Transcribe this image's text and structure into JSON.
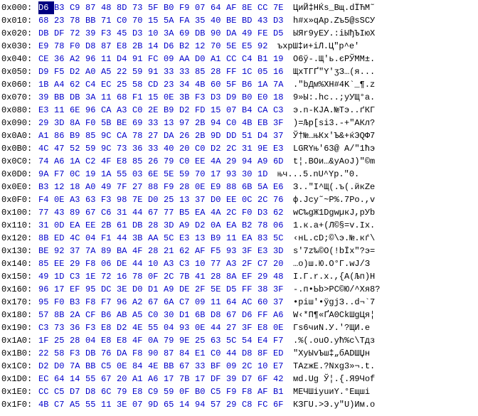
{
  "rows": [
    {
      "addr": "0x000:",
      "bytes": [
        "D6",
        "B3",
        "C9",
        "87",
        "48",
        "8D",
        "73",
        "5F",
        "B0",
        "F9",
        "07",
        "64",
        "AF",
        "8E",
        "CC",
        "7E"
      ],
      "ascii": "ЦиЙ‡HЌs_Вщ.dЇЋМ˜"
    },
    {
      "addr": "0x010:",
      "bytes": [
        "68",
        "23",
        "78",
        "BB",
        "71",
        "C0",
        "70",
        "15",
        "5A",
        "FA",
        "35",
        "40",
        "BE",
        "BD",
        "43",
        "D3"
      ],
      "ascii": "h#x»qАp.Zъ5@sSCУ"
    },
    {
      "addr": "0x020:",
      "bytes": [
        "DB",
        "DF",
        "72",
        "39",
        "F3",
        "45",
        "D3",
        "10",
        "3A",
        "69",
        "DB",
        "90",
        "DA",
        "49",
        "FE",
        "D5"
      ],
      "ascii": "ЫЯr9уEУ.:iЫђЪIюХ"
    },
    {
      "addr": "0x030:",
      "bytes": [
        "E9",
        "78",
        "F0",
        "D8",
        "87",
        "E8",
        "2B",
        "14",
        "D6",
        "B2",
        "12",
        "70",
        "5E",
        "E5",
        "92"
      ],
      "ascii": "ъxpШ‡и+iЛ.Ц\"p^e'"
    },
    {
      "addr": "0x040:",
      "bytes": [
        "CE",
        "36",
        "A2",
        "96",
        "11",
        "D4",
        "91",
        "FC",
        "09",
        "AA",
        "D0",
        "A1",
        "CC",
        "C4",
        "B1",
        "19"
      ],
      "ascii": "О6ў-.Щ'ь.єРЎММ±."
    },
    {
      "addr": "0x050:",
      "bytes": [
        "D9",
        "F5",
        "D2",
        "A0",
        "A5",
        "22",
        "59",
        "91",
        "33",
        "33",
        "85",
        "28",
        "FF",
        "1C",
        "05",
        "16"
      ],
      "ascii": "ЩхТГҐ\"Y'ӡЗ…(я..."
    },
    {
      "addr": "0x060:",
      "bytes": [
        "1B",
        "A4",
        "62",
        "C4",
        "EC",
        "25",
        "58",
        "CD",
        "23",
        "34",
        "4B",
        "60",
        "5F",
        "B6",
        "1A",
        "7A"
      ],
      "ascii": ".\"bДм%XН#4K`_¶.z"
    },
    {
      "addr": "0x070:",
      "bytes": [
        "39",
        "BB",
        "DB",
        "3A",
        "11",
        "68",
        "F1",
        "15",
        "0E",
        "3B",
        "F3",
        "D3",
        "D9",
        "B0",
        "E0",
        "18"
      ],
      "ascii": "9»Ы:.hc..;уУЩ°а."
    },
    {
      "addr": "0x080:",
      "bytes": [
        "E3",
        "11",
        "6E",
        "96",
        "CA",
        "A3",
        "C0",
        "2E",
        "B9",
        "D2",
        "FD",
        "15",
        "07",
        "B4",
        "CA",
        "C3"
      ],
      "ascii": "э.n-КJA.№Тэ..ґКГ"
    },
    {
      "addr": "0x090:",
      "bytes": [
        "29",
        "3D",
        "8A",
        "F0",
        "5B",
        "BE",
        "69",
        "33",
        "13",
        "97",
        "2B",
        "94",
        "C0",
        "4B",
        "EB",
        "3F"
      ],
      "ascii": ")=Љр[si3.-+\"АКл?"
    },
    {
      "addr": "0x0A0:",
      "bytes": [
        "A1",
        "86",
        "B9",
        "85",
        "9C",
        "CA",
        "78",
        "27",
        "DA",
        "26",
        "2B",
        "9D",
        "DD",
        "51",
        "D4",
        "37"
      ],
      "ascii": "Ў†№…њКх'Ъ&+ќЭQФ7"
    },
    {
      "addr": "0x0B0:",
      "bytes": [
        "4C",
        "47",
        "52",
        "59",
        "9C",
        "73",
        "36",
        "33",
        "40",
        "20",
        "C0",
        "D2",
        "2C",
        "31",
        "9E",
        "E3"
      ],
      "ascii": "LGRYњ'63@ А/\"1ћэ"
    },
    {
      "addr": "0x0C0:",
      "bytes": [
        "74",
        "A6",
        "1A",
        "C2",
        "4F",
        "E8",
        "85",
        "26",
        "79",
        "C0",
        "EE",
        "4A",
        "29",
        "94",
        "A9",
        "6D"
      ],
      "ascii": "t¦.ВОи…&yАоJ)\"©m"
    },
    {
      "addr": "0x0D0:",
      "bytes": [
        "9A",
        "F7",
        "0C",
        "19",
        "1A",
        "55",
        "03",
        "6E",
        "5E",
        "59",
        "70",
        "17",
        "93",
        "30",
        "1D"
      ],
      "ascii": "њч...5.nU^Yp.\"0."
    },
    {
      "addr": "0x0E0:",
      "bytes": [
        "B3",
        "12",
        "18",
        "A0",
        "49",
        "7F",
        "27",
        "88",
        "F9",
        "28",
        "0E",
        "E9",
        "88",
        "6B",
        "5A",
        "E6"
      ],
      "ascii": "З..\"I^Щ(.ъ(.йкZе"
    },
    {
      "addr": "0x0F0:",
      "bytes": [
        "F4",
        "0E",
        "A3",
        "63",
        "F3",
        "98",
        "7E",
        "D0",
        "25",
        "13",
        "37",
        "D0",
        "EE",
        "0C",
        "2C",
        "76"
      ],
      "ascii": "ф.Jcу˜~Р%.7Ро.,v"
    },
    {
      "addr": "0x100:",
      "bytes": [
        "77",
        "43",
        "89",
        "67",
        "C6",
        "31",
        "44",
        "67",
        "77",
        "B5",
        "EA",
        "4A",
        "2C",
        "F0",
        "D3",
        "62"
      ],
      "ascii": "wC‰gЖ1DgwµкJ,рУb"
    },
    {
      "addr": "0x110:",
      "bytes": [
        "31",
        "0D",
        "EA",
        "EE",
        "2B",
        "61",
        "DB",
        "28",
        "3D",
        "A9",
        "D2",
        "0A",
        "EA",
        "B2",
        "78",
        "06"
      ],
      "ascii": "1.к.a+(Л©§=v.Іx."
    },
    {
      "addr": "0x120:",
      "bytes": [
        "8B",
        "ED",
        "4C",
        "04",
        "F1",
        "44",
        "3B",
        "AA",
        "5C",
        "E3",
        "13",
        "B9",
        "11",
        "EA",
        "83",
        "5C"
      ],
      "ascii": "‹нL.сD;©\\э.№.кѓ\\"
    },
    {
      "addr": "0x130:",
      "bytes": [
        "BE",
        "92",
        "37",
        "7A",
        "89",
        "BA",
        "4F",
        "28",
        "21",
        "62",
        "AF",
        "F5",
        "93",
        "3F",
        "E3",
        "3D"
      ],
      "ascii": "s'7z‰©O(!bЇх\"?э="
    },
    {
      "addr": "0x140:",
      "bytes": [
        "85",
        "EE",
        "29",
        "F8",
        "06",
        "DE",
        "44",
        "10",
        "A3",
        "C3",
        "10",
        "77",
        "A3",
        "2F",
        "C7",
        "20"
      ],
      "ascii": "…о)ш.Ю.О°Г.wJ/З "
    },
    {
      "addr": "0x150:",
      "bytes": [
        "49",
        "1D",
        "C3",
        "1E",
        "72",
        "16",
        "78",
        "0F",
        "2C",
        "7B",
        "41",
        "28",
        "8A",
        "EF",
        "29",
        "48"
      ],
      "ascii": "І.Г.r.х.,{A(Љп)H"
    },
    {
      "addr": "0x160:",
      "bytes": [
        "96",
        "17",
        "EF",
        "95",
        "DC",
        "3E",
        "D0",
        "D1",
        "A9",
        "DE",
        "2F",
        "5E",
        "D5",
        "FF",
        "38",
        "3F"
      ],
      "ascii": "-.п•Ьb>РС©Ю/^Хя8?"
    },
    {
      "addr": "0x170:",
      "bytes": [
        "95",
        "F0",
        "B3",
        "F8",
        "F7",
        "96",
        "A2",
        "67",
        "6A",
        "C7",
        "09",
        "11",
        "64",
        "AC",
        "60",
        "37"
      ],
      "ascii": "•рiш'•ўgjЗ..d¬`7"
    },
    {
      "addr": "0x180:",
      "bytes": [
        "57",
        "8B",
        "2A",
        "CF",
        "B6",
        "AB",
        "A5",
        "C0",
        "30",
        "D1",
        "6B",
        "D8",
        "67",
        "D6",
        "FF",
        "A6"
      ],
      "ascii": "W‹*П¶«ҐА0СkШgЦя¦"
    },
    {
      "addr": "0x190:",
      "bytes": [
        "C3",
        "73",
        "36",
        "F3",
        "E8",
        "D2",
        "4E",
        "55",
        "04",
        "93",
        "0E",
        "44",
        "27",
        "3F",
        "E8",
        "0E"
      ],
      "ascii": "Гs6чиN.У.'?ЩИ.е"
    },
    {
      "addr": "0x1A0:",
      "bytes": [
        "1F",
        "25",
        "28",
        "04",
        "E8",
        "E8",
        "4F",
        "0A",
        "79",
        "9E",
        "25",
        "63",
        "5C",
        "54",
        "E4",
        "F7"
      ],
      "ascii": ".%(.ouO.yћ%c\\Tдз"
    },
    {
      "addr": "0x1B0:",
      "bytes": [
        "22",
        "58",
        "F3",
        "DB",
        "76",
        "DA",
        "F8",
        "90",
        "87",
        "84",
        "E1",
        "C0",
        "44",
        "D8",
        "8F",
        "ED"
      ],
      "ascii": "\"XуЫvЪш‡„бАDШЏн"
    },
    {
      "addr": "0x1C0:",
      "bytes": [
        "D2",
        "D0",
        "7A",
        "BB",
        "C5",
        "0E",
        "84",
        "4E",
        "BB",
        "67",
        "33",
        "BF",
        "09",
        "2C",
        "10",
        "E7"
      ],
      "ascii": "ТАzжЕ.?Nxg3»¬.t."
    },
    {
      "addr": "0x1D0:",
      "bytes": [
        "EC",
        "64",
        "14",
        "55",
        "67",
        "20",
        "A1",
        "A6",
        "17",
        "7B",
        "17",
        "DF",
        "39",
        "D7",
        "6F",
        "42"
      ],
      "ascii": "мd.Ug Ў¦.{.Я9Чоf"
    },
    {
      "addr": "0x1E0:",
      "bytes": [
        "CC",
        "C5",
        "D7",
        "D8",
        "6C",
        "79",
        "E8",
        "C9",
        "59",
        "0F",
        "B0",
        "C5",
        "F9",
        "F8",
        "AF",
        "B1"
      ],
      "ascii": "МЕЧШіyuиY.°Ещші"
    },
    {
      "addr": "0x1F0:",
      "bytes": [
        "4B",
        "C7",
        "A5",
        "55",
        "11",
        "3E",
        "07",
        "9D",
        "65",
        "14",
        "94",
        "57",
        "29",
        "C8",
        "FC",
        "6F"
      ],
      "ascii": "КЗГU.>Э.у\"U)Им.о"
    }
  ]
}
